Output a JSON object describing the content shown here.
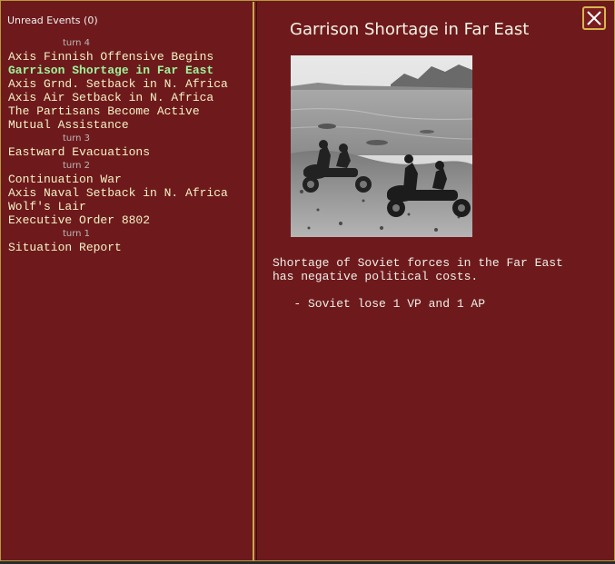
{
  "left_panel": {
    "header": "Unread Events (0)",
    "entries": [
      {
        "kind": "turn",
        "text": "turn 4"
      },
      {
        "kind": "event",
        "text": "Axis Finnish Offensive Begins"
      },
      {
        "kind": "event",
        "text": "Garrison Shortage in Far East",
        "selected": true
      },
      {
        "kind": "event",
        "text": "Axis Grnd. Setback in N. Africa"
      },
      {
        "kind": "event",
        "text": "Axis Air Setback in N. Africa"
      },
      {
        "kind": "event",
        "text": "The Partisans Become Active"
      },
      {
        "kind": "event",
        "text": "Mutual Assistance"
      },
      {
        "kind": "turn",
        "text": "turn 3"
      },
      {
        "kind": "event",
        "text": "Eastward Evacuations"
      },
      {
        "kind": "turn",
        "text": "turn 2"
      },
      {
        "kind": "event",
        "text": "Continuation War"
      },
      {
        "kind": "event",
        "text": "Axis Naval Setback in N. Africa"
      },
      {
        "kind": "event",
        "text": "Wolf's Lair"
      },
      {
        "kind": "event",
        "text": "Executive Order 8802"
      },
      {
        "kind": "turn",
        "text": "turn 1"
      },
      {
        "kind": "event",
        "text": "Situation Report"
      }
    ]
  },
  "detail": {
    "title": "Garrison Shortage in Far East",
    "description": "Shortage of Soviet forces in the Far East\nhas negative political costs.\n\n   - Soviet lose 1 VP and 1 AP",
    "close_icon": "close-x-icon",
    "photo": "black-and-white photo of soldiers on motorcycles with sidecars on a rocky shore"
  },
  "colors": {
    "panel_bg": "#6e1a1c",
    "border_gold": "#c8a84a",
    "event_text": "#f4f2c8",
    "selected_text": "#9cf59c",
    "turn_text": "#b8b8b8"
  }
}
